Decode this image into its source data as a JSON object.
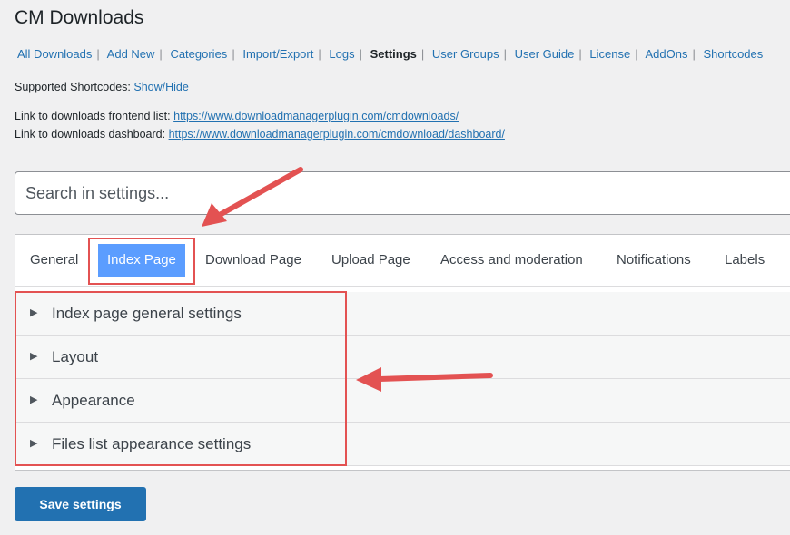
{
  "page": {
    "title": "CM Downloads"
  },
  "subnav": {
    "items": [
      {
        "label": "All Downloads"
      },
      {
        "label": "Add New"
      },
      {
        "label": "Categories"
      },
      {
        "label": "Import/Export"
      },
      {
        "label": "Logs"
      },
      {
        "label": "Settings",
        "current": true
      },
      {
        "label": "User Groups"
      },
      {
        "label": "User Guide"
      },
      {
        "label": "License"
      },
      {
        "label": "AddOns"
      },
      {
        "label": "Shortcodes"
      }
    ],
    "separator": "|"
  },
  "shortcodes": {
    "label": "Supported Shortcodes:",
    "link": "Show/Hide"
  },
  "links": {
    "frontend": {
      "label": "Link to downloads frontend list:",
      "url": "https://www.downloadmanagerplugin.com/cmdownloads/"
    },
    "dashboard": {
      "label": "Link to downloads dashboard:",
      "url": "https://www.downloadmanagerplugin.com/cmdownload/dashboard/"
    }
  },
  "search": {
    "placeholder": "Search in settings..."
  },
  "tabs": [
    {
      "label": "General"
    },
    {
      "label": "Index Page",
      "active": true
    },
    {
      "label": "Download Page"
    },
    {
      "label": "Upload Page"
    },
    {
      "label": "Access and moderation"
    },
    {
      "label": "Notifications"
    },
    {
      "label": "Labels"
    }
  ],
  "sections": [
    {
      "label": "Index page general settings"
    },
    {
      "label": "Layout"
    },
    {
      "label": "Appearance"
    },
    {
      "label": "Files list appearance settings"
    }
  ],
  "icons": {
    "section_toggle": "triangle-right-icon"
  },
  "save_button": {
    "label": "Save settings"
  },
  "colors": {
    "accent": "#2271b1",
    "active_tab": "#5b9dff",
    "annotation": "#e35252"
  }
}
